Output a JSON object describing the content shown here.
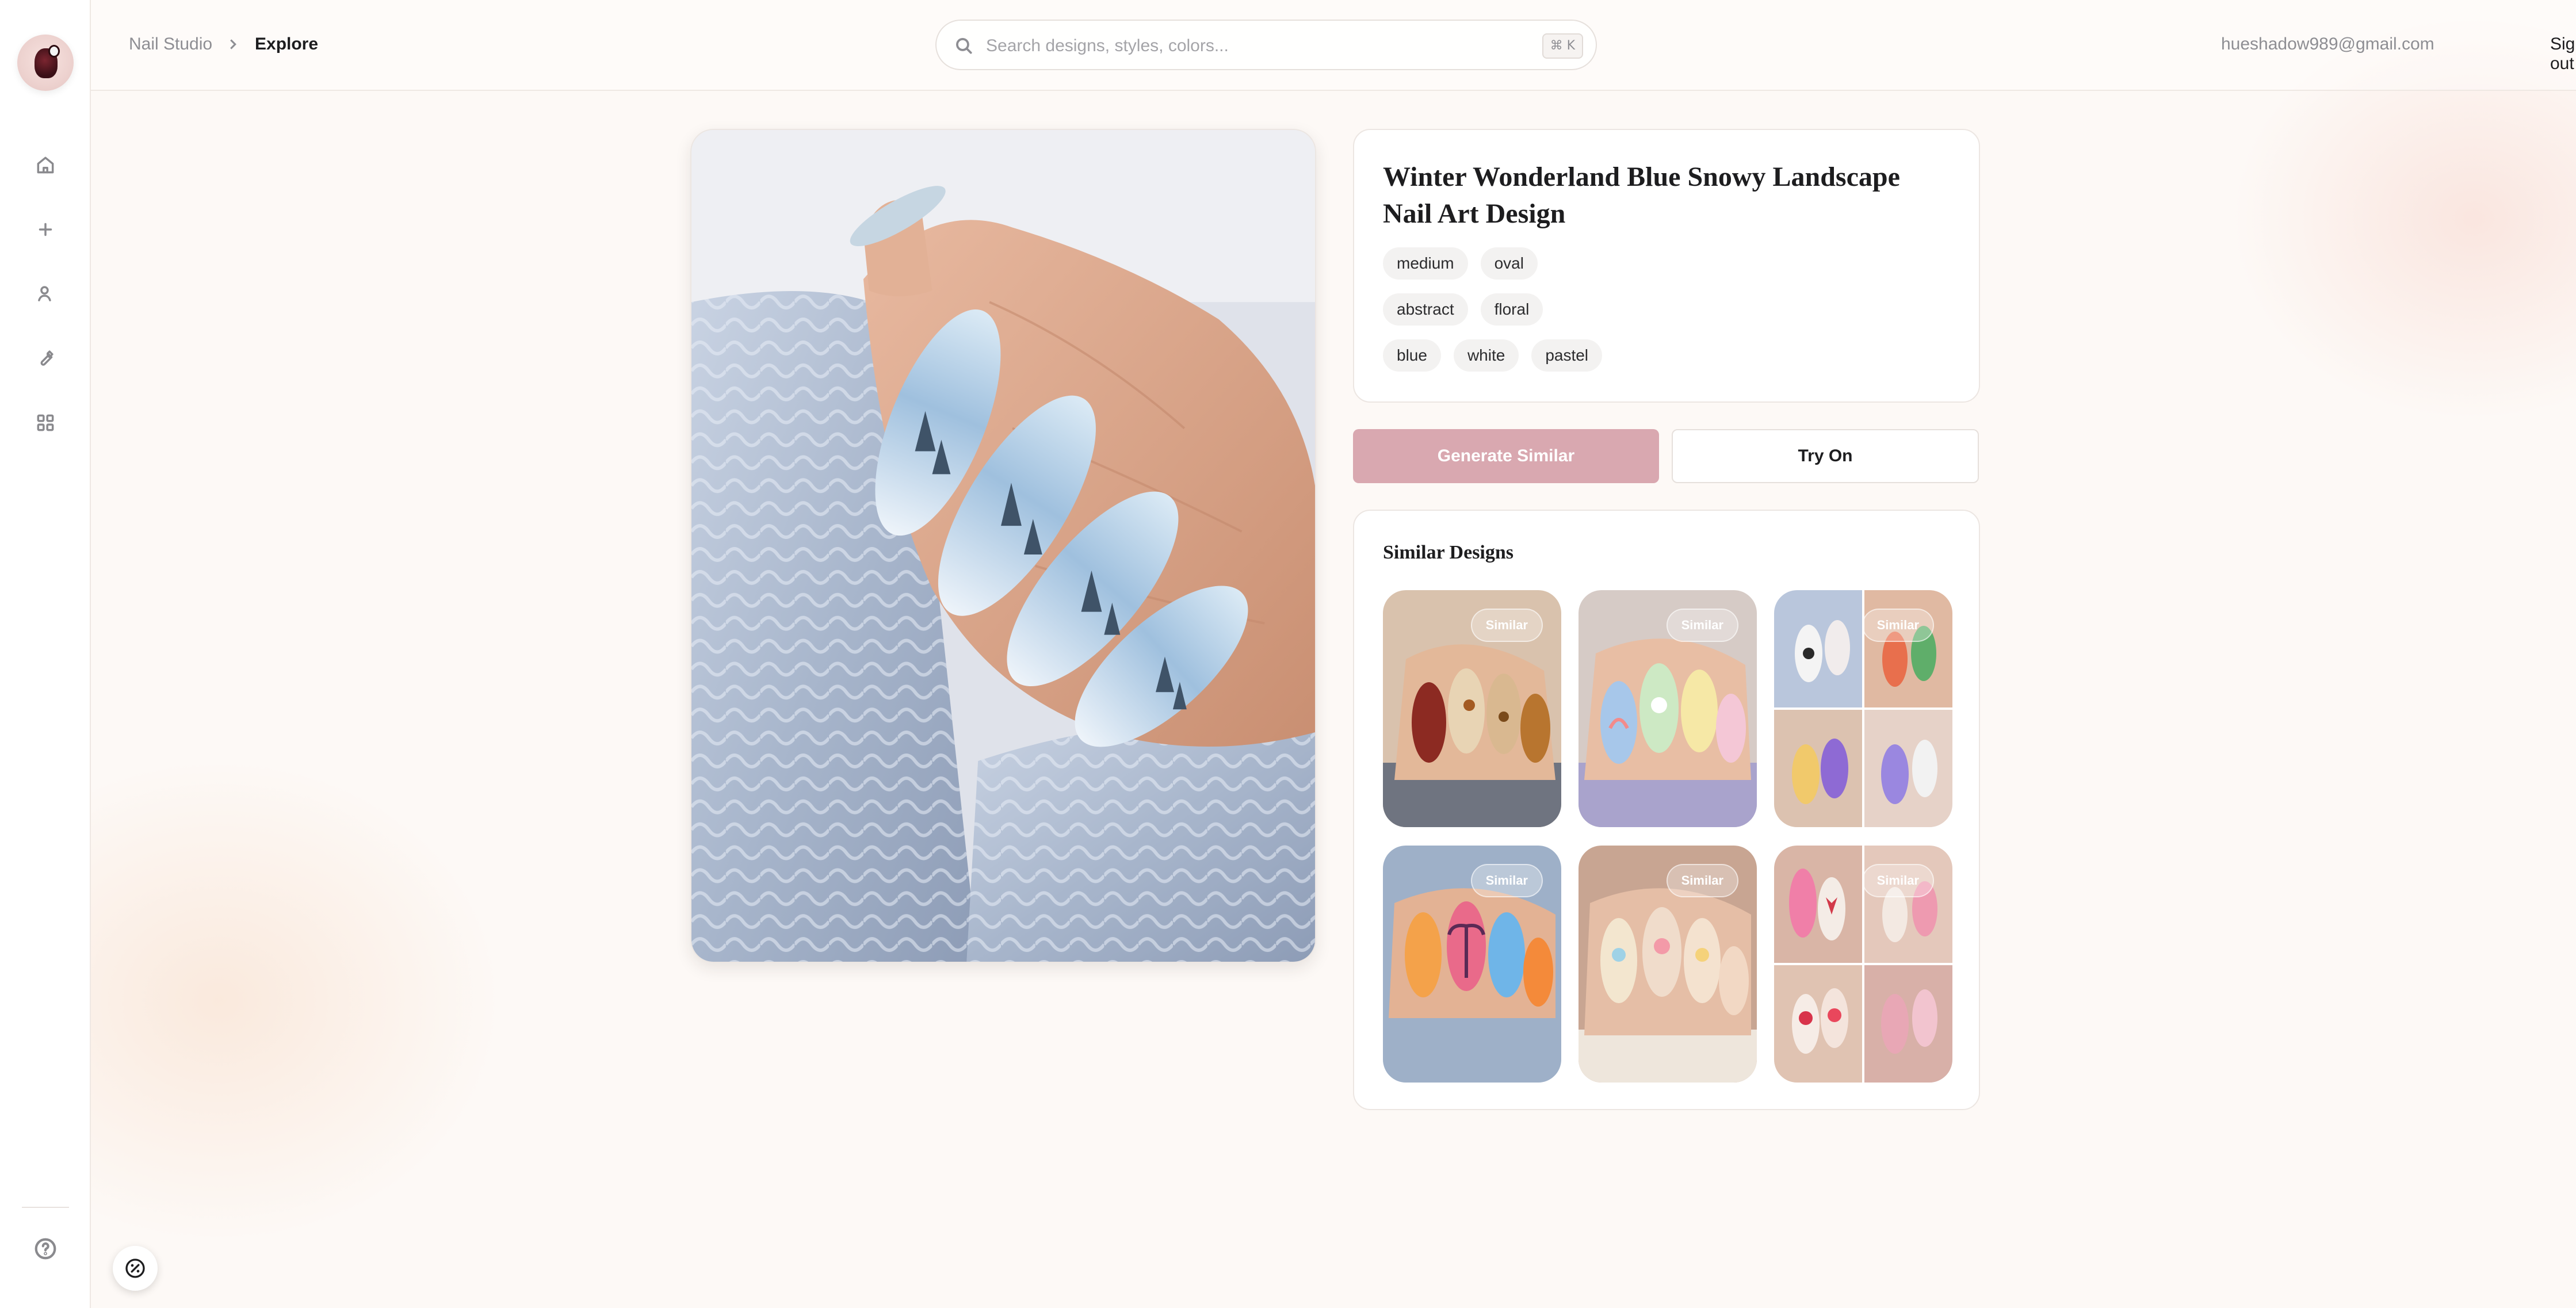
{
  "header": {
    "breadcrumb_root": "Nail Studio",
    "breadcrumb_current": "Explore",
    "search_placeholder": "Search designs, styles, colors...",
    "search_shortcut": "⌘ K",
    "user_email": "hueshadow989@gmail.com",
    "signout_label": "Sign out"
  },
  "sidebar": {
    "items": [
      {
        "icon": "home-icon"
      },
      {
        "icon": "plus-icon"
      },
      {
        "icon": "user-icon"
      },
      {
        "icon": "wrench-icon"
      },
      {
        "icon": "grid-icon"
      }
    ],
    "help_icon": "help-icon"
  },
  "design": {
    "title": "Winter Wonderland Blue Snowy Landscape Nail Art Design",
    "tag_rows": [
      [
        "medium",
        "oval"
      ],
      [
        "abstract",
        "floral"
      ],
      [
        "blue",
        "white",
        "pastel"
      ]
    ]
  },
  "actions": {
    "generate_label": "Generate Similar",
    "try_on_label": "Try On"
  },
  "similar": {
    "title": "Similar Designs",
    "badge_label": "Similar",
    "items": [
      {
        "theme": "autumn leaves"
      },
      {
        "theme": "pastel kawaii"
      },
      {
        "theme": "cartoon collage"
      },
      {
        "theme": "tropical sunset"
      },
      {
        "theme": "pastel balloons"
      },
      {
        "theme": "pink tulips collage"
      }
    ]
  },
  "colors": {
    "accent": "#d9a8b0",
    "background": "#fdf9f6",
    "card": "#ffffff"
  }
}
